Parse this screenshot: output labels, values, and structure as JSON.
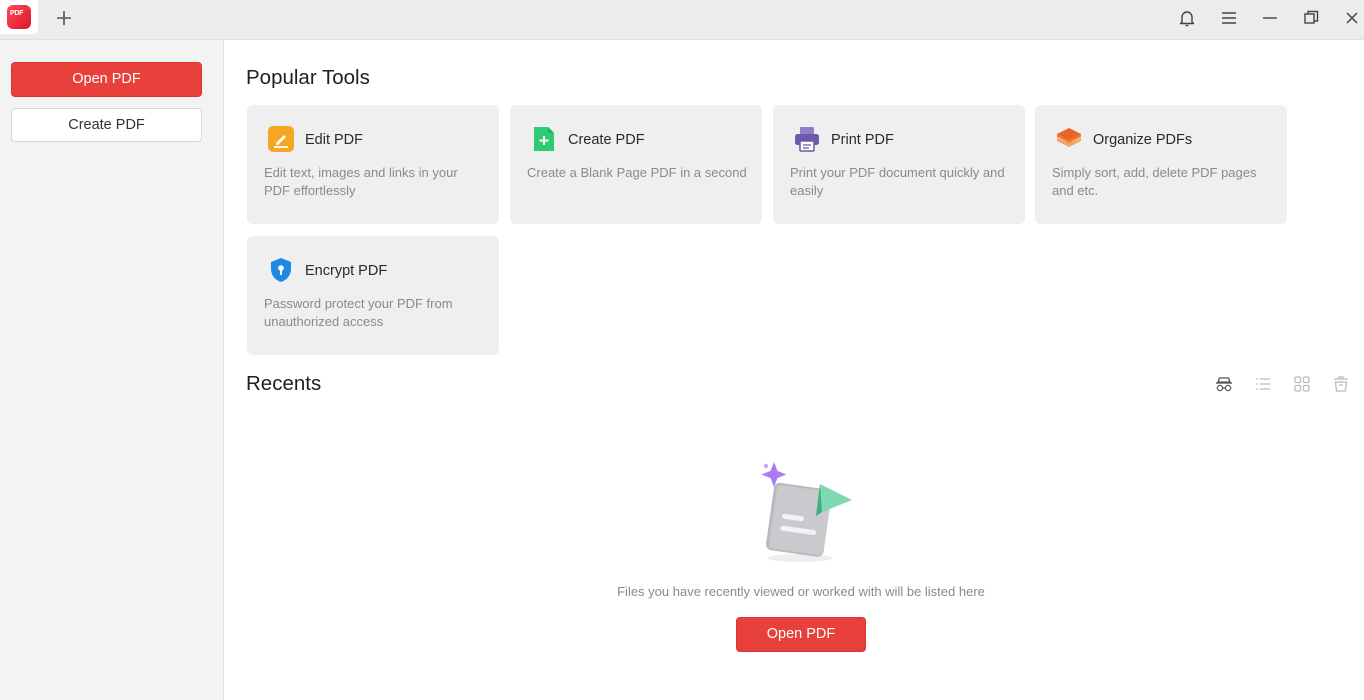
{
  "app": {
    "logo_text": "PDF"
  },
  "sidebar": {
    "open_label": "Open PDF",
    "create_label": "Create PDF"
  },
  "popular_tools": {
    "title": "Popular Tools",
    "tools": [
      {
        "icon": "edit-pdf-icon",
        "title": "Edit PDF",
        "desc": "Edit text, images and links in your PDF effortlessly",
        "color": "#f5a623"
      },
      {
        "icon": "create-pdf-icon",
        "title": "Create PDF",
        "desc": "Create a Blank Page PDF in a second",
        "color": "#2ecc71"
      },
      {
        "icon": "print-pdf-icon",
        "title": "Print PDF",
        "desc": "Print your PDF document quickly and easily",
        "color": "#6c5ca8"
      },
      {
        "icon": "organize-pdfs-icon",
        "title": "Organize PDFs",
        "desc": "Simply sort, add, delete PDF pages and etc.",
        "color": "#f07a2e"
      },
      {
        "icon": "encrypt-pdf-icon",
        "title": "Encrypt PDF",
        "desc": "Password protect your PDF from unauthorized access",
        "color": "#1e88e5"
      }
    ]
  },
  "recents": {
    "title": "Recents",
    "empty_text": "Files you have recently viewed or worked with will be listed here",
    "open_label": "Open PDF"
  },
  "colors": {
    "accent": "#e8403a",
    "card_bg": "#efefef",
    "sidebar_bg": "#f3f3f3"
  }
}
